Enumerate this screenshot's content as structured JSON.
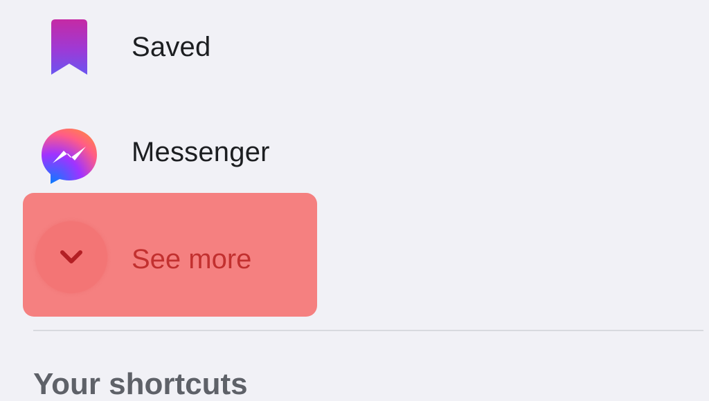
{
  "sidebar": {
    "items": [
      {
        "label": "Saved",
        "icon": "bookmark-icon"
      },
      {
        "label": "Messenger",
        "icon": "messenger-icon"
      }
    ],
    "see_more": {
      "label": "See more",
      "icon": "chevron-down-icon"
    },
    "section_title": "Your shortcuts"
  },
  "colors": {
    "page_bg": "#f1f1f6",
    "highlight": "#f58080",
    "highlight_text": "#c2302f",
    "text": "#1c1e21",
    "section_text": "#5e6168"
  }
}
